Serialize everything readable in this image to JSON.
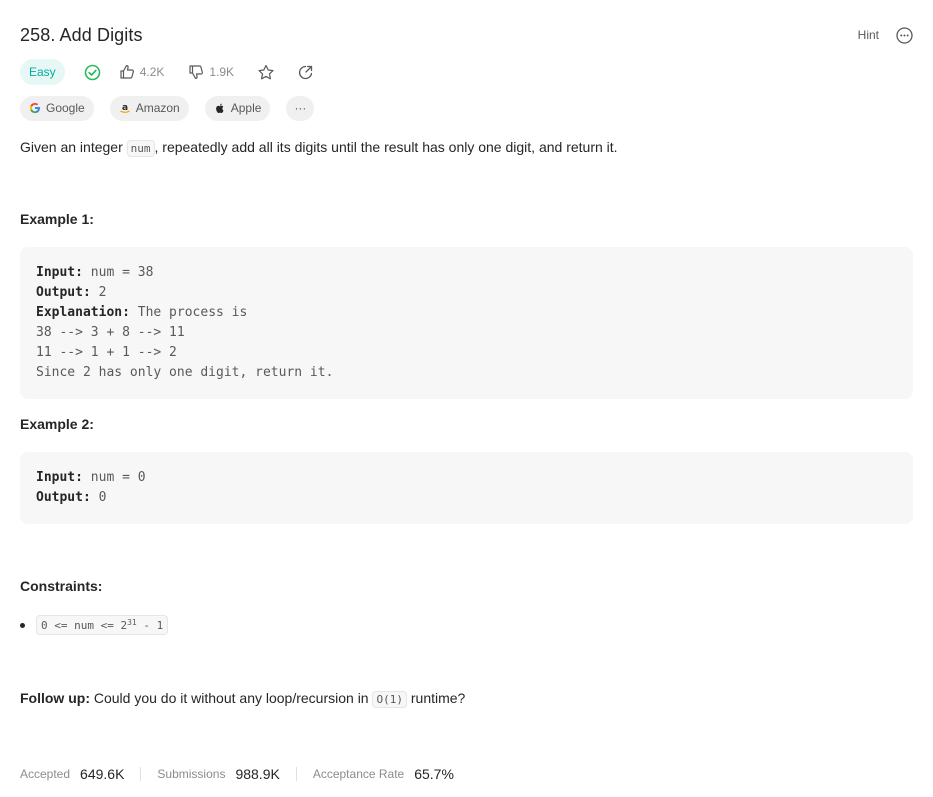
{
  "problem": {
    "title": "258. Add Digits",
    "hint_label": "Hint"
  },
  "meta": {
    "difficulty": "Easy",
    "likes": "4.2K",
    "dislikes": "1.9K"
  },
  "tags": {
    "items": [
      {
        "label": "Google",
        "icon": "google-icon"
      },
      {
        "label": "Amazon",
        "icon": "amazon-icon"
      },
      {
        "label": "Apple",
        "icon": "apple-icon"
      }
    ],
    "more_label": "···"
  },
  "description": {
    "prefix": "Given an integer ",
    "code": "num",
    "suffix": ", repeatedly add all its digits until the result has only one digit, and return it."
  },
  "example1": {
    "heading": "Example 1:",
    "input_label": "Input:",
    "input_value": " num = 38",
    "output_label": "Output:",
    "output_value": " 2",
    "explanation_label": "Explanation:",
    "explanation_value": " The process is",
    "lines": [
      "38 --> 3 + 8 --> 11",
      "11 --> 1 + 1 --> 2",
      "Since 2 has only one digit, return it."
    ]
  },
  "example2": {
    "heading": "Example 2:",
    "input_label": "Input:",
    "input_value": " num = 0",
    "output_label": "Output:",
    "output_value": " 0"
  },
  "constraints": {
    "heading": "Constraints:",
    "item_prefix": "0 <= num <= 2",
    "item_sup": "31",
    "item_suffix": " - 1"
  },
  "followup": {
    "label": "Follow up:",
    "text_before": " Could you do it without any loop/recursion in ",
    "code": "O(1)",
    "text_after": " runtime?"
  },
  "stats": {
    "accepted_label": "Accepted",
    "accepted_value": "649.6K",
    "submissions_label": "Submissions",
    "submissions_value": "988.9K",
    "rate_label": "Acceptance Rate",
    "rate_value": "65.7%"
  },
  "colors": {
    "easy": "#00af9b",
    "easy_bg": "#e6f7f5",
    "solved_check": "#2cbb5d"
  }
}
